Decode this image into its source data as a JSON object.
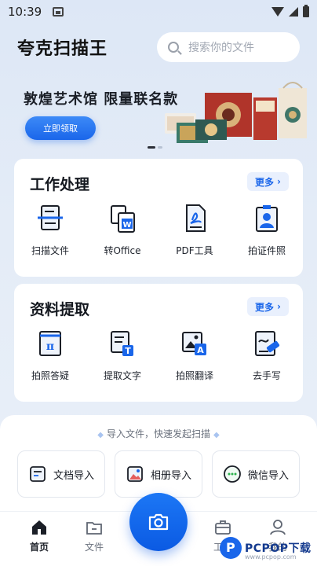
{
  "status_bar": {
    "time": "10:39"
  },
  "header": {
    "app_title": "夸克扫描王",
    "search_placeholder": "搜索你的文件"
  },
  "banner": {
    "headline": "敦煌艺术馆 限量联名款",
    "cta_label": "立即领取",
    "slide_count": 2,
    "active_slide": 1
  },
  "work_section": {
    "title": "工作处理",
    "more_label": "更多",
    "tools": [
      {
        "label": "扫描文件",
        "icon": "scan-doc-icon"
      },
      {
        "label": "转Office",
        "icon": "convert-office-icon"
      },
      {
        "label": "PDF工具",
        "icon": "pdf-tool-icon"
      },
      {
        "label": "拍证件照",
        "icon": "id-photo-icon"
      }
    ]
  },
  "extract_section": {
    "title": "资料提取",
    "more_label": "更多",
    "tools": [
      {
        "label": "拍照答疑",
        "icon": "math-pi-icon"
      },
      {
        "label": "提取文字",
        "icon": "text-extract-icon"
      },
      {
        "label": "拍照翻译",
        "icon": "photo-translate-icon"
      },
      {
        "label": "去手写",
        "icon": "erase-handwriting-icon"
      }
    ]
  },
  "import_panel": {
    "hint": "导入文件，快速发起扫描",
    "buttons": [
      {
        "label": "文档导入",
        "icon": "document-import-icon"
      },
      {
        "label": "相册导入",
        "icon": "album-import-icon"
      },
      {
        "label": "微信导入",
        "icon": "wechat-import-icon"
      }
    ]
  },
  "tabbar": {
    "tabs": [
      {
        "label": "首页",
        "icon": "home-icon",
        "active": true
      },
      {
        "label": "文件",
        "icon": "folder-icon",
        "active": false
      },
      {
        "label": "工具",
        "icon": "toolbox-icon",
        "active": false
      },
      {
        "label": "我的",
        "icon": "user-icon",
        "active": false
      }
    ],
    "camera_icon": "camera-icon"
  },
  "watermark": {
    "text": "PCPOP下载",
    "sub": "www.pcpop.com"
  },
  "colors": {
    "accent": "#1a66ea",
    "page_bg": "#e4ecf7",
    "card_bg": "#ffffff"
  }
}
